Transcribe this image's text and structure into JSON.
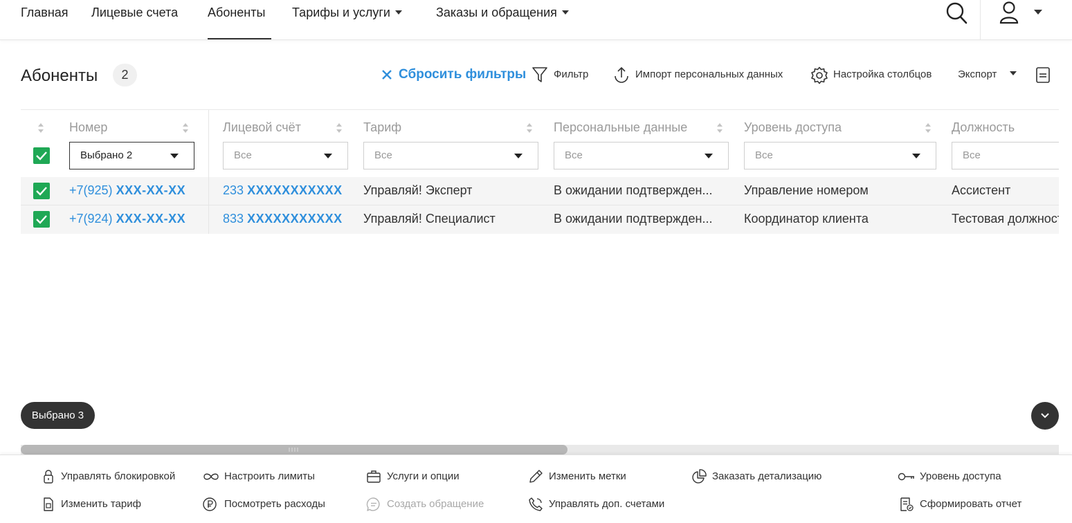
{
  "nav": {
    "items": [
      {
        "label": "Главная"
      },
      {
        "label": "Лицевые счета"
      },
      {
        "label": "Абоненты"
      },
      {
        "label": "Тарифы и услуги"
      },
      {
        "label": "Заказы и обращения"
      }
    ],
    "active_index": 2
  },
  "page": {
    "title": "Абоненты",
    "count": "2"
  },
  "toolbar": {
    "reset": "Сбросить фильтры",
    "filter": "Фильтр",
    "import": "Импорт персональных данных",
    "columns": "Настройка столбцов",
    "export": "Экспорт"
  },
  "table": {
    "headers": [
      "Номер",
      "Лицевой счёт",
      "Тариф",
      "Персональные данные",
      "Уровень доступа",
      "Должность"
    ],
    "filters": [
      "Выбрано 2",
      "Все",
      "Все",
      "Все",
      "Все",
      "Все"
    ],
    "rows": [
      {
        "phone_prefix": "+7(925)",
        "phone_mask": "XXX-XX-XX",
        "account_prefix": "233",
        "account_mask": "XXXXXXXXXXX",
        "tariff": "Управляй! Эксперт",
        "personal": "В ожидании подтвержден...",
        "access": "Управление номером",
        "position": "Ассистент"
      },
      {
        "phone_prefix": "+7(924)",
        "phone_mask": "XXX-XX-XX",
        "account_prefix": "833",
        "account_mask": "XXXXXXXXXXX",
        "tariff": "Управляй! Специалист",
        "personal": "В ожидании подтвержден...",
        "access": "Координатор клиента",
        "position": "Тестовая должность"
      }
    ]
  },
  "selection": {
    "label": "Выбрано 3"
  },
  "actions": {
    "row1": [
      "Управлять блокировкой",
      "Настроить лимиты",
      "Услуги и опции",
      "Изменить метки",
      "Заказать детализацию",
      "Уровень доступа"
    ],
    "row2": [
      "Изменить тариф",
      "Посмотреть расходы",
      "Создать обращение",
      "Управлять доп. счетами",
      "Сформировать отчет"
    ]
  },
  "colors": {
    "accent": "#2f8fdc",
    "checkbox": "#1fa855",
    "dark": "#333333"
  }
}
